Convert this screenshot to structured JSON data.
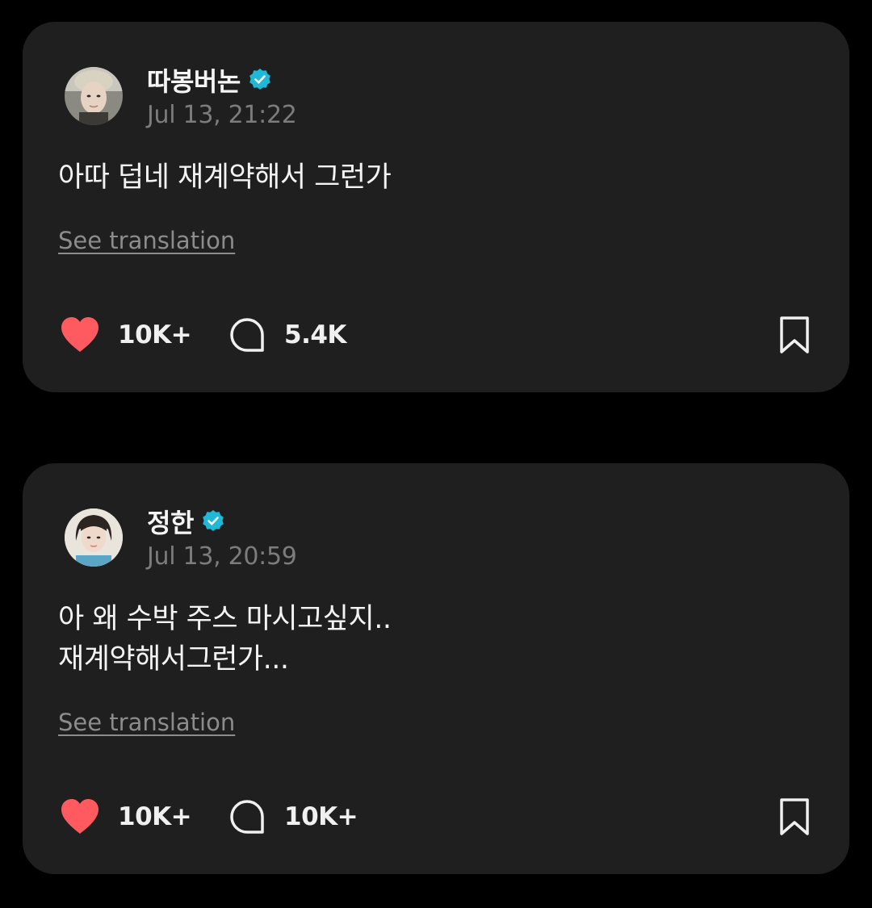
{
  "colors": {
    "background": "#000000",
    "card": "#1f1f1f",
    "heart": "#ff5a5f",
    "verified": "#1fb8d6",
    "muted_text": "#7c7c7c"
  },
  "posts": [
    {
      "username": "따봉버논",
      "verified": true,
      "timestamp": "Jul 13, 21:22",
      "lines": [
        "아따 덥네 재계약해서 그런가"
      ],
      "translation_label": "See translation",
      "likes": "10K+",
      "comments": "5.4K",
      "icons": {
        "like": "heart-icon",
        "comment": "comment-bubble-icon",
        "bookmark": "bookmark-icon"
      }
    },
    {
      "username": "정한",
      "verified": true,
      "timestamp": "Jul 13, 20:59",
      "lines": [
        "아 왜 수박 주스 마시고싶지..",
        "재계약해서그런가..."
      ],
      "translation_label": "See translation",
      "likes": "10K+",
      "comments": "10K+",
      "icons": {
        "like": "heart-icon",
        "comment": "comment-bubble-icon",
        "bookmark": "bookmark-icon"
      }
    }
  ]
}
